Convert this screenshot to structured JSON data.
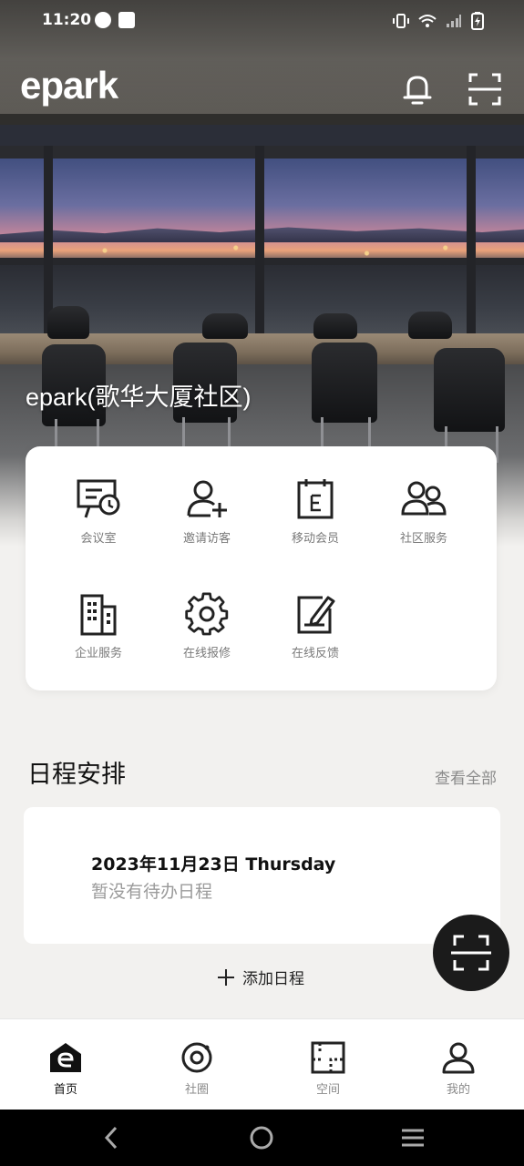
{
  "status_bar": {
    "time": "11:20",
    "icons": [
      "speed-icon",
      "shopping-bag-icon",
      "vibrate-icon",
      "wifi-icon",
      "signal-icon",
      "battery-charging-icon"
    ]
  },
  "header": {
    "logo": "epark",
    "actions": [
      "bell-icon",
      "scan-icon"
    ],
    "community_name": "epark(歌华大厦社区)"
  },
  "services": {
    "items": [
      {
        "label": "会议室",
        "icon": "meeting-room-icon"
      },
      {
        "label": "邀请访客",
        "icon": "invite-visitor-icon"
      },
      {
        "label": "移动会员",
        "icon": "member-card-icon"
      },
      {
        "label": "社区服务",
        "icon": "community-service-icon"
      },
      {
        "label": "企业服务",
        "icon": "enterprise-building-icon"
      },
      {
        "label": "在线报修",
        "icon": "repair-gear-icon"
      },
      {
        "label": "在线反馈",
        "icon": "feedback-edit-icon"
      }
    ]
  },
  "schedule": {
    "title": "日程安排",
    "view_all": "查看全部",
    "date": "2023年11月23日 Thursday",
    "empty_text": "暂没有待办日程",
    "add_label": "添加日程"
  },
  "bottom_nav": {
    "items": [
      {
        "label": "首页",
        "icon": "home-icon",
        "active": true
      },
      {
        "label": "社圈",
        "icon": "community-circle-icon",
        "active": false
      },
      {
        "label": "空间",
        "icon": "space-icon",
        "active": false
      },
      {
        "label": "我的",
        "icon": "profile-icon",
        "active": false
      }
    ]
  },
  "colors": {
    "accent": "#1b1b1b",
    "background": "#f2f1ef",
    "label_gray": "#7a7a7a"
  }
}
